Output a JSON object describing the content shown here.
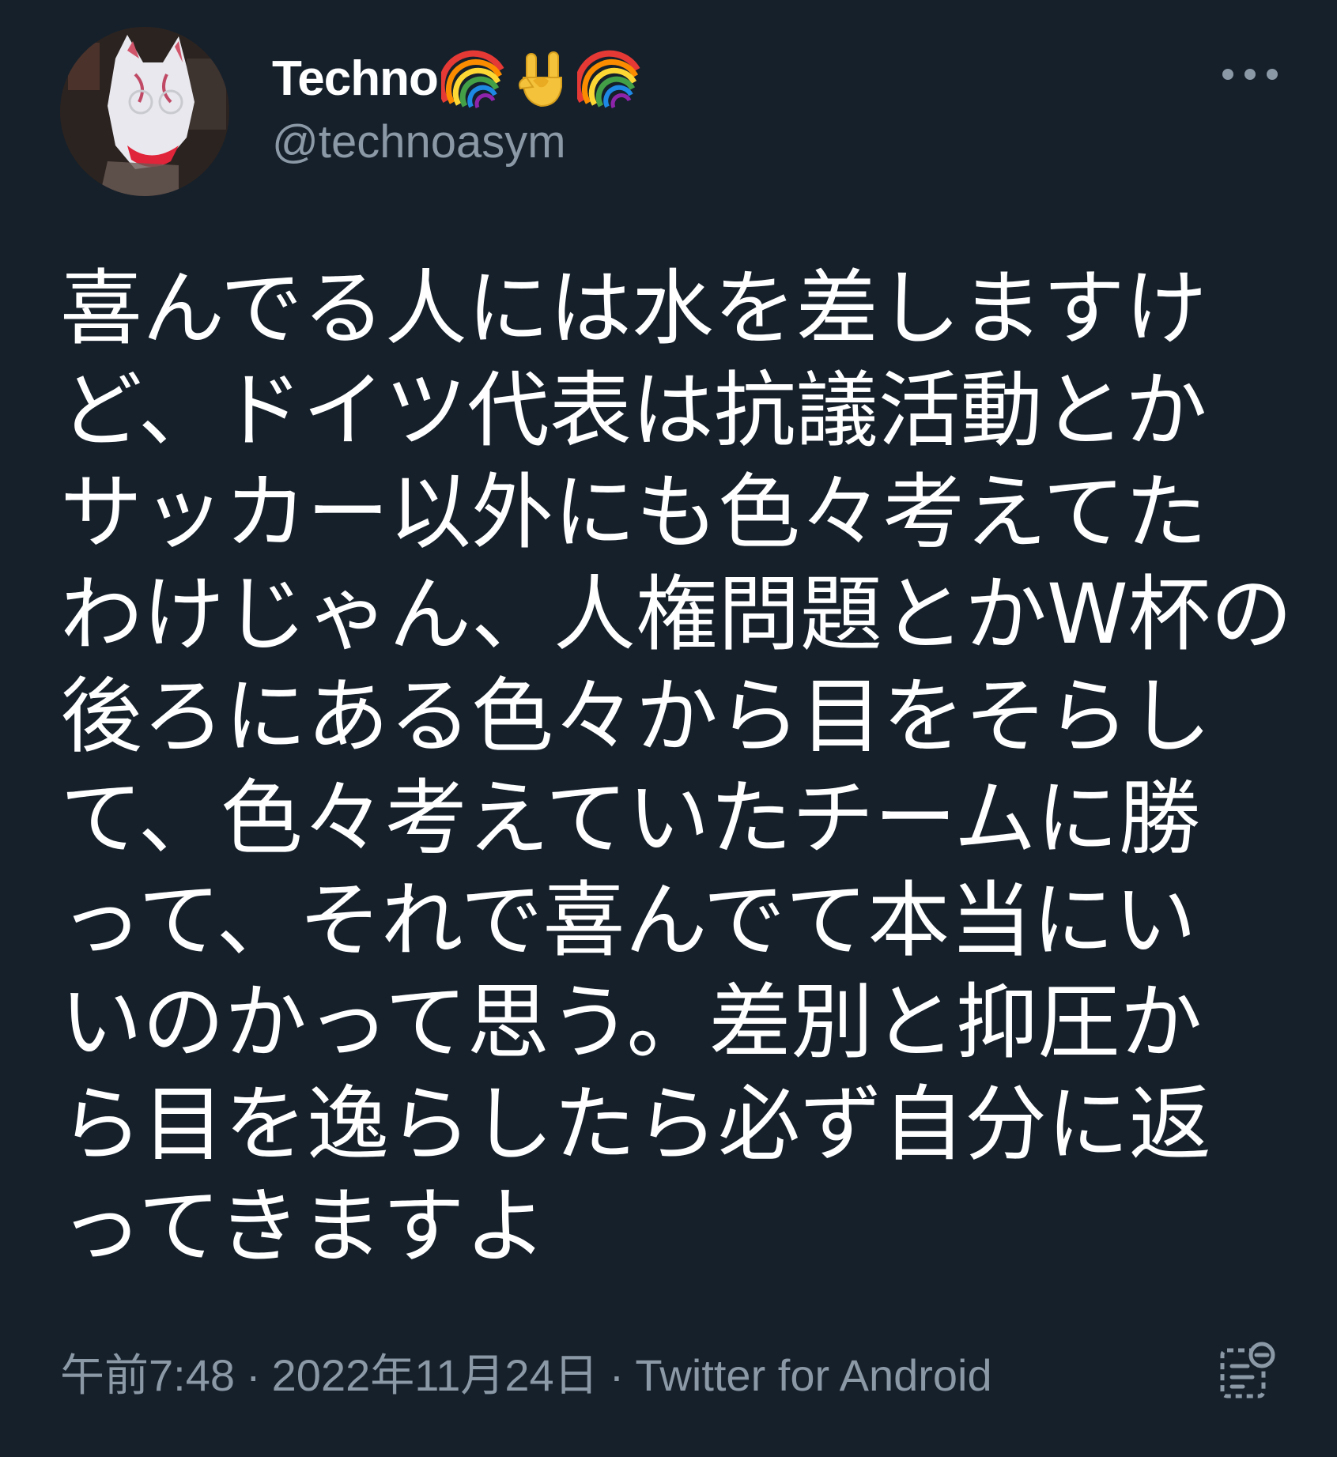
{
  "author": {
    "display_name": "Techno",
    "emoji": [
      "rainbow",
      "sign-of-the-horns",
      "rainbow"
    ],
    "handle": "@technoasym"
  },
  "tweet": {
    "lines": [
      "喜んでる人には水を差しますけ",
      "ど、ドイツ代表は抗議活動とか",
      "サッカー以外にも色々考えてた",
      "わけじゃん、人権問題とかW杯の",
      "後ろにある色々から目をそらし",
      "て、色々考えていたチームに勝",
      "って、それで喜んでて本当にい",
      "いのかって思う。差別と抑圧か",
      "ら目を逸らしたら必ず自分に返",
      "ってきますよ"
    ]
  },
  "footer": {
    "time": "午前7:48",
    "date": "2022年11月24日",
    "source": "Twitter for Android",
    "separator": "·"
  },
  "icons": {
    "more": "more-options-icon",
    "analytics": "view-analytics-icon"
  },
  "colors": {
    "background": "#15202b",
    "text_primary": "#ffffff",
    "text_secondary": "#8b98a5"
  }
}
